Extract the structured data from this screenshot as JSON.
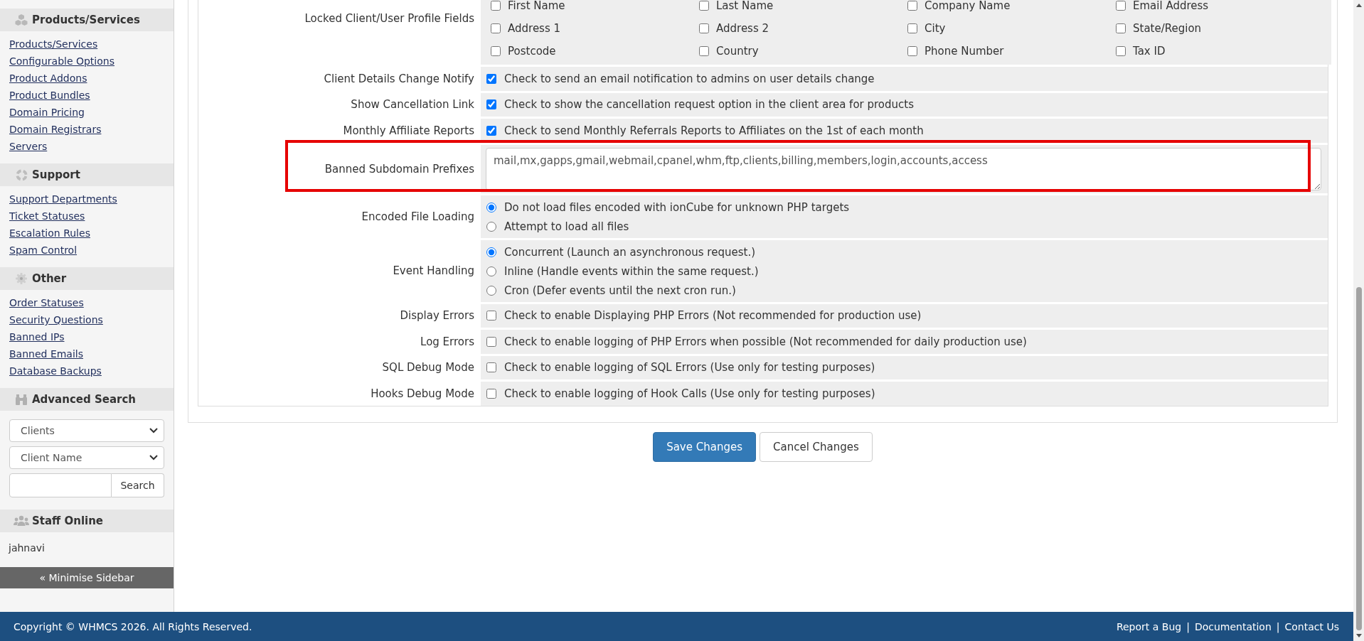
{
  "sidebar": {
    "sections": [
      {
        "kind": "links",
        "title": "Products/Services",
        "links": [
          "Products/Services",
          "Configurable Options",
          "Product Addons",
          "Product Bundles",
          "Domain Pricing",
          "Domain Registrars",
          "Servers"
        ]
      },
      {
        "kind": "links",
        "title": "Support",
        "links": [
          "Support Departments",
          "Ticket Statuses",
          "Escalation Rules",
          "Spam Control"
        ]
      },
      {
        "kind": "links",
        "title": "Other",
        "links": [
          "Order Statuses",
          "Security Questions",
          "Banned IPs",
          "Banned Emails",
          "Database Backups"
        ]
      },
      {
        "kind": "search",
        "title": "Advanced Search",
        "dropdowns": [
          {
            "value": "Clients"
          },
          {
            "value": "Client Name"
          }
        ],
        "search_button": "Search"
      },
      {
        "kind": "staff",
        "title": "Staff Online",
        "staff": [
          "jahnavi"
        ]
      }
    ],
    "minimise_button": "« Minimise Sidebar"
  },
  "settings": {
    "rows": [
      {
        "kind": "checkgrid",
        "label": "Locked Client/User Profile Fields",
        "options": [
          {
            "label": "First Name",
            "checked": false
          },
          {
            "label": "Last Name",
            "checked": false
          },
          {
            "label": "Company Name",
            "checked": false
          },
          {
            "label": "Email Address",
            "checked": false
          },
          {
            "label": "Address 1",
            "checked": false
          },
          {
            "label": "Address 2",
            "checked": false
          },
          {
            "label": "City",
            "checked": false
          },
          {
            "label": "State/Region",
            "checked": false
          },
          {
            "label": "Postcode",
            "checked": false
          },
          {
            "label": "Country",
            "checked": false
          },
          {
            "label": "Phone Number",
            "checked": false
          },
          {
            "label": "Tax ID",
            "checked": false
          }
        ]
      },
      {
        "kind": "checkbox",
        "label": "Client Details Change Notify",
        "checked": true,
        "text": "Check to send an email notification to admins on user details change"
      },
      {
        "kind": "checkbox",
        "label": "Show Cancellation Link",
        "checked": true,
        "text": "Check to show the cancellation request option in the client area for products"
      },
      {
        "kind": "checkbox",
        "label": "Monthly Affiliate Reports",
        "checked": true,
        "text": "Check to send Monthly Referrals Reports to Affiliates on the 1st of each month"
      },
      {
        "kind": "textarea",
        "label": "Banned Subdomain Prefixes",
        "value": "mail,mx,gapps,gmail,webmail,cpanel,whm,ftp,clients,billing,members,login,accounts,access",
        "highlighted": true
      },
      {
        "kind": "radios",
        "label": "Encoded File Loading",
        "options": [
          {
            "label": "Do not load files encoded with ionCube for unknown PHP targets",
            "selected": true
          },
          {
            "label": "Attempt to load all files",
            "selected": false
          }
        ]
      },
      {
        "kind": "radios",
        "label": "Event Handling",
        "options": [
          {
            "label": "Concurrent (Launch an asynchronous request.)",
            "selected": true
          },
          {
            "label": "Inline (Handle events within the same request.)",
            "selected": false
          },
          {
            "label": "Cron (Defer events until the next cron run.)",
            "selected": false
          }
        ]
      },
      {
        "kind": "checkbox",
        "label": "Display Errors",
        "checked": false,
        "text": "Check to enable Displaying PHP Errors (Not recommended for production use)"
      },
      {
        "kind": "checkbox",
        "label": "Log Errors",
        "checked": false,
        "text": "Check to enable logging of PHP Errors when possible (Not recommended for daily production use)"
      },
      {
        "kind": "checkbox",
        "label": "SQL Debug Mode",
        "checked": false,
        "text": "Check to enable logging of SQL Errors (Use only for testing purposes)"
      },
      {
        "kind": "checkbox",
        "label": "Hooks Debug Mode",
        "checked": false,
        "text": "Check to enable logging of Hook Calls (Use only for testing purposes)"
      }
    ]
  },
  "buttons": [
    {
      "label": "Save Changes",
      "kind": "primary"
    },
    {
      "label": "Cancel Changes",
      "kind": "default"
    }
  ],
  "footer": {
    "copyright": "Copyright © WHMCS 2026. All Rights Reserved.",
    "links": [
      "Report a Bug",
      "Documentation",
      "Contact Us"
    ],
    "separators": [
      "|",
      "|"
    ]
  }
}
